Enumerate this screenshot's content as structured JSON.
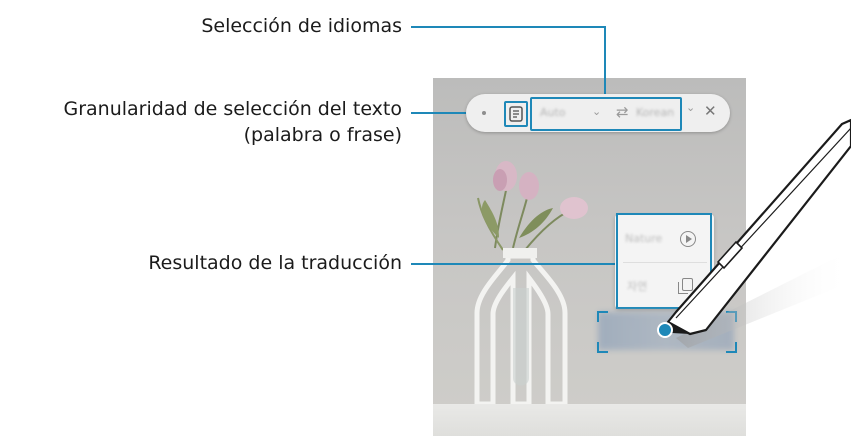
{
  "callouts": {
    "language_selection": "Selección de idiomas",
    "granularity_line1": "Granularidad de selección del texto",
    "granularity_line2": "(palabra o frase)",
    "translation_result": "Resultado de la traducción"
  },
  "toolbar": {
    "source_language": "Auto",
    "target_language": "Korean",
    "swap_icon": "swap-arrows",
    "close_icon": "x"
  },
  "result_card": {
    "translation_text": "Nature",
    "second_text": "자연",
    "play_icon": "play-circle",
    "copy_icon": "copy"
  },
  "colors": {
    "accent": "#1e88b8",
    "toolbar_bg": "#efefef",
    "card_bg": "#f4f4f4"
  }
}
